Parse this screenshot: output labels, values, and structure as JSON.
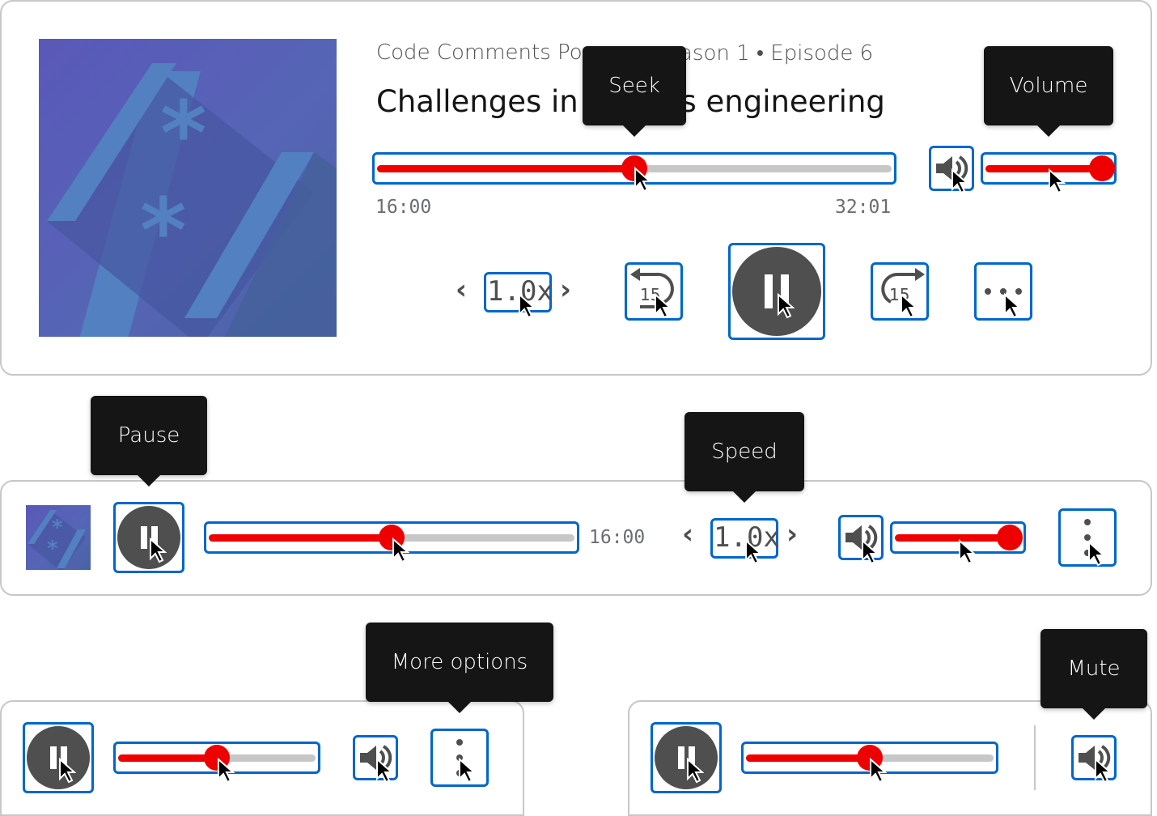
{
  "player_full": {
    "subtitle": "Code Comments Podcast • Season 1 • Episode 6",
    "subtitle_visible_left": "Code Comments Po",
    "subtitle_visible_right": "ason 1 • Episode 6",
    "title_visible_left": "Challenges in s",
    "title_visible_right": "ns engineering",
    "elapsed": "16:00",
    "duration": "32:01",
    "seek_progress": 0.5,
    "volume_level": 1.0,
    "speed": "1.0x",
    "rewind_label": "15",
    "forward_label": "15",
    "tooltips": {
      "seek": "Seek",
      "volume": "Volume"
    }
  },
  "player_compact": {
    "elapsed": "16:00",
    "seek_progress": 0.5,
    "volume_level": 1.0,
    "speed": "1.0x",
    "tooltips": {
      "pause": "Pause",
      "speed": "Speed"
    }
  },
  "player_mini_left": {
    "seek_progress": 0.5,
    "tooltips": {
      "more": "More options"
    }
  },
  "player_mini_right": {
    "seek_progress": 0.5,
    "tooltips": {
      "mute": "Mute"
    }
  },
  "colors": {
    "accent": "#ee0000",
    "focus": "#0066cc",
    "track": "#c7c7c7",
    "icon": "#4f4f4f",
    "tooltip": "#151515"
  }
}
